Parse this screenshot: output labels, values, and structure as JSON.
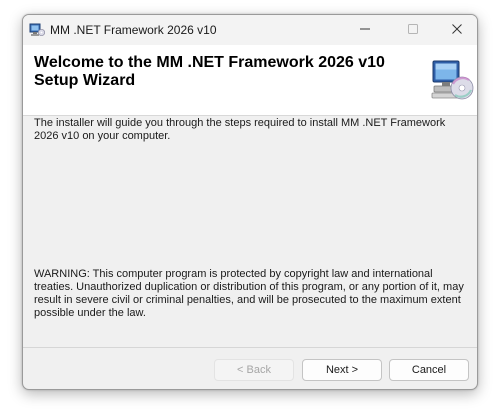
{
  "window": {
    "title": "MM .NET Framework 2026 v10"
  },
  "header": {
    "title": "Welcome to the MM .NET Framework 2026 v10 Setup Wizard",
    "graphic_icon": "computer-cd-icon"
  },
  "content": {
    "intro": "The installer will guide you through the steps required to install MM .NET Framework 2026 v10 on your computer.",
    "warning": "WARNING: This computer program is protected by copyright law and international treaties. Unauthorized duplication or distribution of this program, or any portion of it, may result in severe civil or criminal penalties, and will be prosecuted to the maximum extent possible under the law."
  },
  "buttons": {
    "back": "< Back",
    "next": "Next >",
    "cancel": "Cancel"
  },
  "buttons_state": {
    "back_enabled": false
  },
  "colors": {
    "window_bg": "#f0f0f0",
    "header_bg": "#ffffff",
    "disabled_text": "#a6a6a6"
  }
}
